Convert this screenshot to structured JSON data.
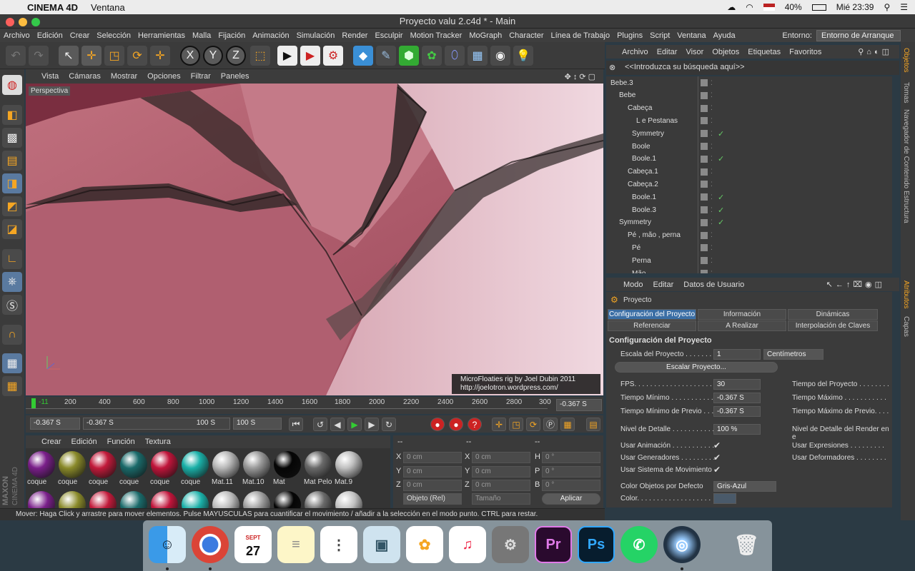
{
  "menubar": {
    "app": "CINEMA 4D",
    "items": [
      "Ventana"
    ],
    "battery": "40%",
    "clock": "Mié 23:39"
  },
  "window": {
    "title": "Proyecto valu 2.c4d * - Main"
  },
  "app_menu": {
    "items": [
      "Archivo",
      "Edición",
      "Crear",
      "Selección",
      "Herramientas",
      "Malla",
      "Fijación",
      "Animación",
      "Simulación",
      "Render",
      "Esculpir",
      "Motion Tracker",
      "MoGraph",
      "Character",
      "Línea de Trabajo",
      "Plugins",
      "Script",
      "Ventana",
      "Ayuda"
    ],
    "environment_label": "Entorno:",
    "environment_value": "Entorno de Arranque"
  },
  "viewport": {
    "menu": [
      "Vista",
      "Cámaras",
      "Mostrar",
      "Opciones",
      "Filtrar",
      "Paneles"
    ],
    "label": "Perspectiva",
    "credit_line1": "MicroFloaties rig by Joel Dubin 2011",
    "credit_line2": "http://joelotron.wordpress.com/"
  },
  "timeline": {
    "ticks": [
      "-11",
      "200",
      "400",
      "600",
      "800",
      "1000",
      "1200",
      "1400",
      "1600",
      "1800",
      "2000",
      "2200",
      "2400",
      "2600",
      "2800",
      "300"
    ],
    "current": "-0.367 S"
  },
  "transport": {
    "start": "-0.367 S",
    "range_start": "-0.367 S",
    "range_end": "100 S",
    "end": "100 S"
  },
  "materials": {
    "menu": [
      "Crear",
      "Edición",
      "Función",
      "Textura"
    ],
    "items": [
      {
        "name": "coque",
        "color": "#7a1f8a"
      },
      {
        "name": "coque",
        "color": "#8a8a2a"
      },
      {
        "name": "coque",
        "color": "#c21a3a"
      },
      {
        "name": "coque",
        "color": "#1a6a6a"
      },
      {
        "name": "coque",
        "color": "#c0143a"
      },
      {
        "name": "coque",
        "color": "#1ab0a8"
      },
      {
        "name": "Mat.11",
        "color": "#b8b8b8"
      },
      {
        "name": "Mat.10",
        "color": "#9a9a9a"
      },
      {
        "name": "Mat",
        "color": "#050505"
      },
      {
        "name": "Mat Pelo",
        "color": "#6a6a6a"
      },
      {
        "name": "Mat.9",
        "color": "#c0c0c0"
      }
    ],
    "brand1": "MAXON",
    "brand2": "CINEMA 4D"
  },
  "coords": {
    "header1": "--",
    "header2": "--",
    "header3": "--",
    "rows": [
      {
        "a": "X",
        "av": "0 cm",
        "b": "X",
        "bv": "0 cm",
        "c": "H",
        "cv": "0 °"
      },
      {
        "a": "Y",
        "av": "0 cm",
        "b": "Y",
        "bv": "0 cm",
        "c": "P",
        "cv": "0 °"
      },
      {
        "a": "Z",
        "av": "0 cm",
        "b": "Z",
        "bv": "0 cm",
        "c": "B",
        "cv": "0 °"
      }
    ],
    "mode": "Objeto (Rel)",
    "size": "Tamaño",
    "apply": "Aplicar"
  },
  "status": "Mover: Haga Click y arrastre para mover elementos. Pulse MAYUSCULAS para cuantificar el movimiento / añadir a la selección en el modo punto. CTRL para restar.",
  "objects": {
    "menu": [
      "Archivo",
      "Editar",
      "Visor",
      "Objetos",
      "Etiquetas",
      "Favoritos"
    ],
    "search": "<<Introduzca su búsqueda aquí>>",
    "rows": [
      {
        "name": "Bebe.3",
        "check": ""
      },
      {
        "name": "Bebe",
        "check": ""
      },
      {
        "name": "Cabeça",
        "check": ""
      },
      {
        "name": "L e Pestanas",
        "check": ""
      },
      {
        "name": "Symmetry",
        "check": "✓"
      },
      {
        "name": "Boole",
        "check": ""
      },
      {
        "name": "Boole.1",
        "check": "✓"
      },
      {
        "name": "Cabeça.1",
        "check": ""
      },
      {
        "name": "Cabeça.2",
        "check": ""
      },
      {
        "name": "Boole.1",
        "check": "✓"
      },
      {
        "name": "Boole.3",
        "check": "✓"
      },
      {
        "name": "Symmetry",
        "check": "✓"
      },
      {
        "name": "Pé , mão , perna",
        "check": ""
      },
      {
        "name": "Pé",
        "check": ""
      },
      {
        "name": "Perna",
        "check": ""
      },
      {
        "name": "Mão",
        "check": ""
      }
    ]
  },
  "right_tabs": [
    "Objetos",
    "Tomas",
    "Navegador de Contenido",
    "Estructura",
    "Atributos",
    "Capas"
  ],
  "attributes": {
    "menu": [
      "Modo",
      "Editar",
      "Datos de Usuario"
    ],
    "title": "Proyecto",
    "tabs_row1": [
      "Configuración del Proyecto",
      "Información",
      "Dinámicas"
    ],
    "tabs_row2": [
      "Referenciar",
      "A Realizar",
      "Interpolación de Claves"
    ],
    "section": "Configuración del Proyecto",
    "scale_label": "Escala del Proyecto . . . . . . .",
    "scale_value": "1",
    "scale_unit": "Centímetros",
    "scale_button": "Escalar Proyecto...",
    "fps_label": "FPS. . . . . . . . . . . . . . . . . . . .",
    "fps_value": "30",
    "project_time_label": "Tiempo del Proyecto . . . . . . . .",
    "min_time_label": "Tiempo Mínimo . . . . . . . . . . .",
    "min_time_value": "-0.367 S",
    "max_time_label": "Tiempo Máximo . . . . . . . . . . .",
    "min_preview_label": "Tiempo Mínimo de Previo . . .",
    "min_preview_value": "-0.367 S",
    "max_preview_label": "Tiempo Máximo de Previo. . . .",
    "lod_label": "Nivel de Detalle . . . . . . . . . . .",
    "lod_value": "100 %",
    "lod_render_label": "Nivel de Detalle del Render en e",
    "use_anim_label": "Usar Animación . . . . . . . . . . .",
    "use_expr_label": "Usar Expresiones . . . . . . . . .",
    "use_gen_label": "Usar Generadores . . . . . . . . .",
    "use_deform_label": "Usar Deformadores . . . . . . . .",
    "use_motion_label": "Usar Sistema de Movimiento",
    "color_objects_label": "Color Objetos por Defecto",
    "color_objects_value": "Gris-Azul",
    "color_label": "Color. . . . . . . . . . . . . . . . . . ."
  },
  "dock": {
    "calendar_month": "SEPT",
    "calendar_day": "27"
  }
}
